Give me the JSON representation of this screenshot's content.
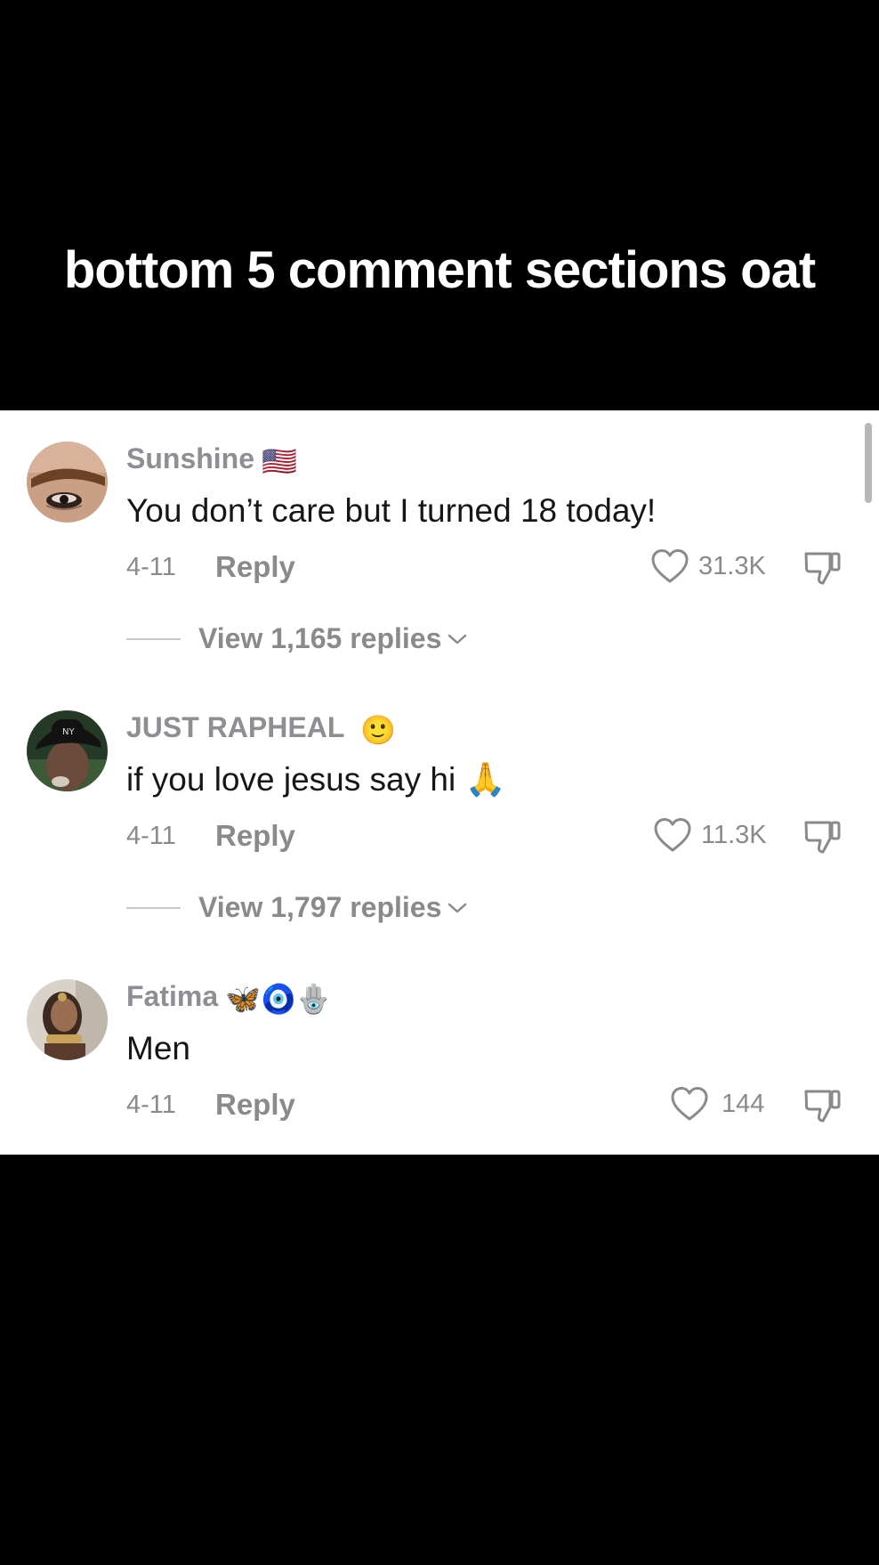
{
  "caption": "bottom 5 comment sections oat",
  "comments": [
    {
      "username": "Sunshine",
      "name_decoration": "🇺🇸",
      "text": "You don’t care but I turned 18 today!",
      "date": "4-11",
      "reply_label": "Reply",
      "likes": "31.3K",
      "view_replies": "View 1,165 replies",
      "avatar_icon": "eyebrow-closeup-avatar"
    },
    {
      "username": "JUST RAPHEAL",
      "name_decoration": "🙂",
      "text": "if you love jesus say hi 🙏",
      "date": "4-11",
      "reply_label": "Reply",
      "likes": "11.3K",
      "view_replies": "View 1,797 replies",
      "avatar_icon": "man-in-cap-avatar"
    },
    {
      "username": "Fatima",
      "name_decoration": "🦋🧿🪬",
      "text": "Men",
      "date": "4-11",
      "reply_label": "Reply",
      "likes": "144",
      "avatar_icon": "hand-portrait-avatar"
    }
  ],
  "colors": {
    "background": "#000000",
    "panel": "#ffffff",
    "muted_text": "#8a8a8a",
    "body_text": "#161616"
  }
}
